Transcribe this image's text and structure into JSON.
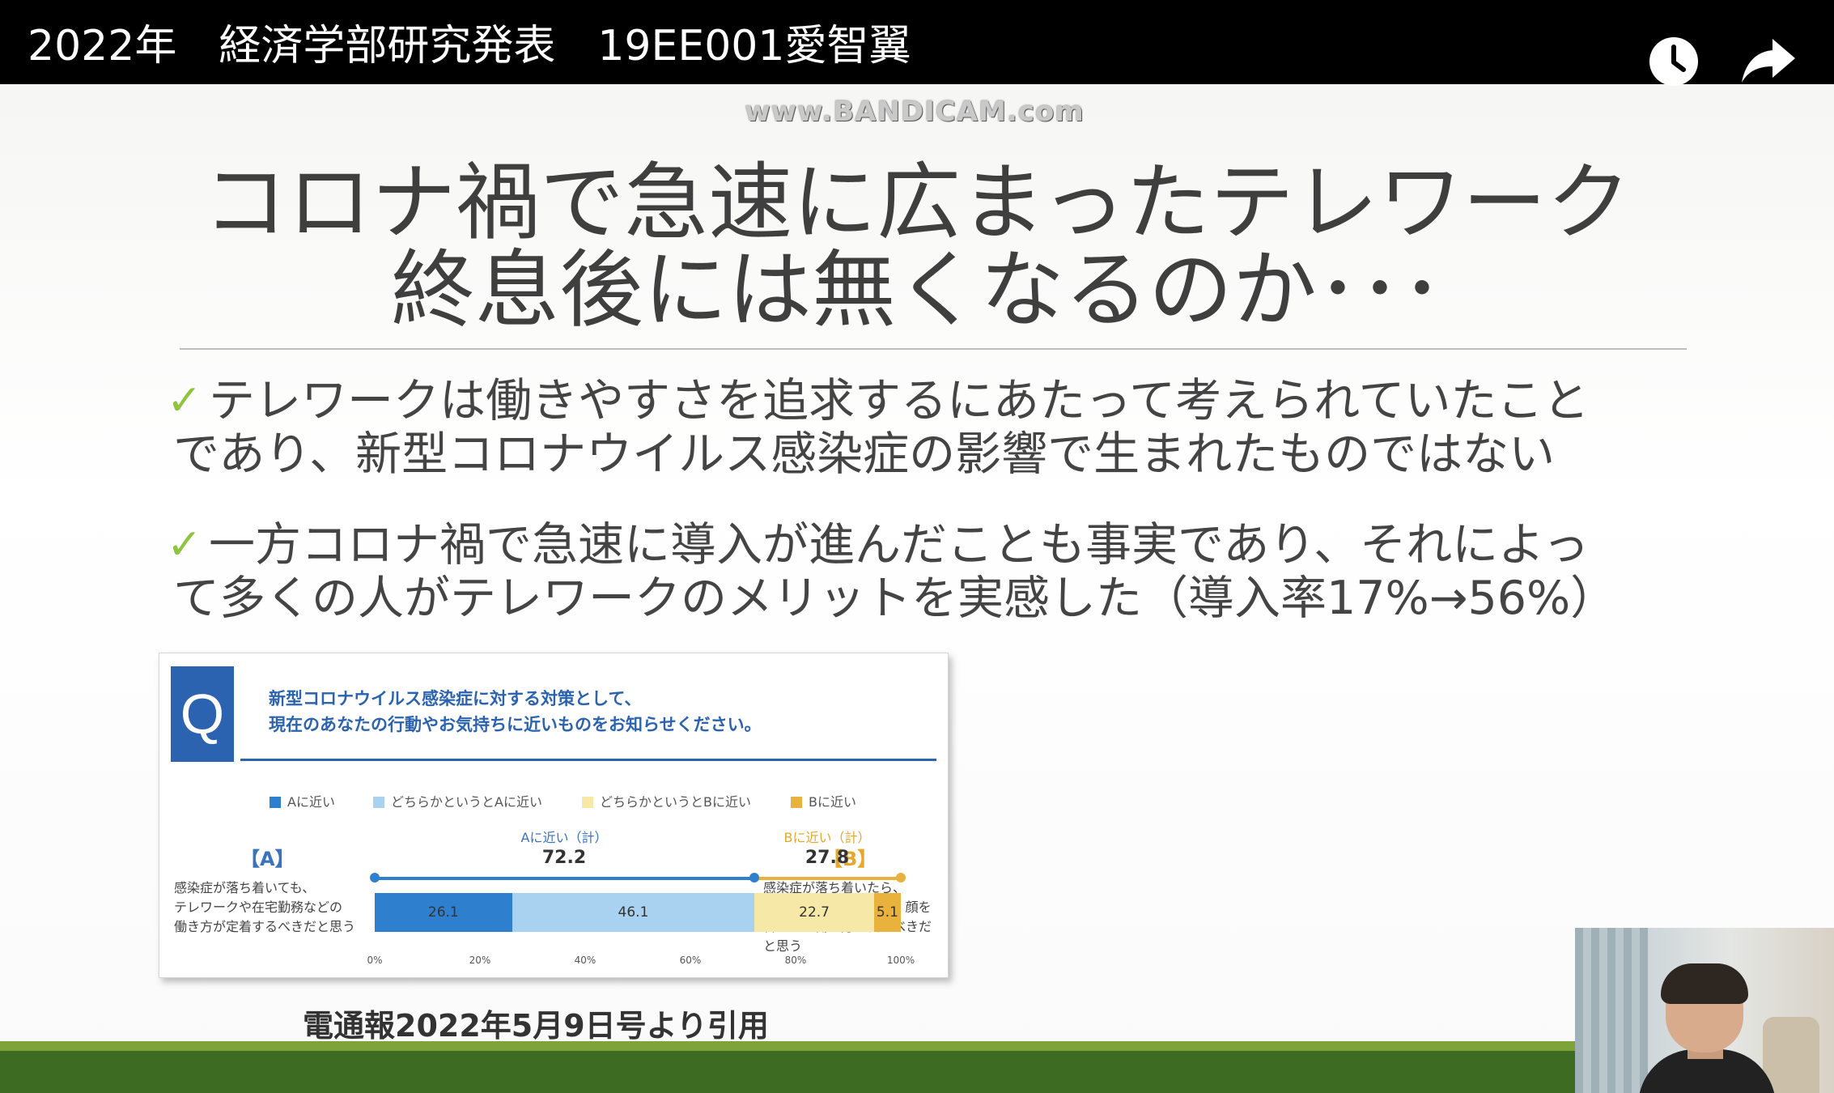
{
  "video": {
    "title": "2022年　経済学部研究発表　19EE001愛智翼",
    "watch_later_icon": "clock-icon",
    "share_icon": "share-arrow-icon",
    "watermark": "www.BANDICAM.com"
  },
  "slide": {
    "headline_line1": "コロナ禍で急速に広まったテレワーク",
    "headline_line2": "終息後には無くなるのか･･･",
    "bullets": [
      {
        "check": "✓",
        "line1": "テレワークは働きやすさを追求するにあたって考えられていたこと",
        "line2": "であり、新型コロナウイルス感染症の影響で生まれたものではない"
      },
      {
        "check": "✓",
        "line1": "一方コロナ禍で急速に導入が進んだことも事実であり、それによっ",
        "line2": "て多くの人がテレワークのメリットを実感した（導入率17%→56%）"
      }
    ],
    "citation": "電通報2022年5月9日号より引用",
    "accent_color": "#8ec43f",
    "footer_color": "#3d6b22"
  },
  "chart_data": {
    "type": "bar",
    "q_label": "Q",
    "question_line1": "新型コロナウイルス感染症に対する対策として、",
    "question_line2": "現在のあなたの行動やお気持ちに近いものをお知らせください。",
    "series": [
      {
        "name": "Aに近い",
        "values": [
          26.1
        ],
        "color": "#2f7fcf"
      },
      {
        "name": "どちらかというとAに近い",
        "values": [
          46.1
        ],
        "color": "#a9d1f0"
      },
      {
        "name": "どちらかというとBに近い",
        "values": [
          22.7
        ],
        "color": "#f6e9a8"
      },
      {
        "name": "Bに近い",
        "values": [
          5.1
        ],
        "color": "#e9b23c"
      }
    ],
    "option_a_label": "【A】",
    "option_a_text": [
      "感染症が落ち着いても、",
      "テレワークや在宅勤務などの",
      "働き方が定着するべきだと思う"
    ],
    "option_b_label": "【B】",
    "option_b_text": [
      "感染症が落ち着いたら、",
      "オフィスなどに出勤し、顔を",
      "合わせる働き方に戻るべきだ",
      "と思う"
    ],
    "sum_a_label": "Aに近い（計）",
    "sum_a_value": 72.2,
    "sum_b_label": "Bに近い（計）",
    "sum_b_value": 27.8,
    "x_ticks": [
      "0%",
      "20%",
      "40%",
      "60%",
      "80%",
      "100%"
    ],
    "xlim": [
      0,
      100
    ]
  }
}
